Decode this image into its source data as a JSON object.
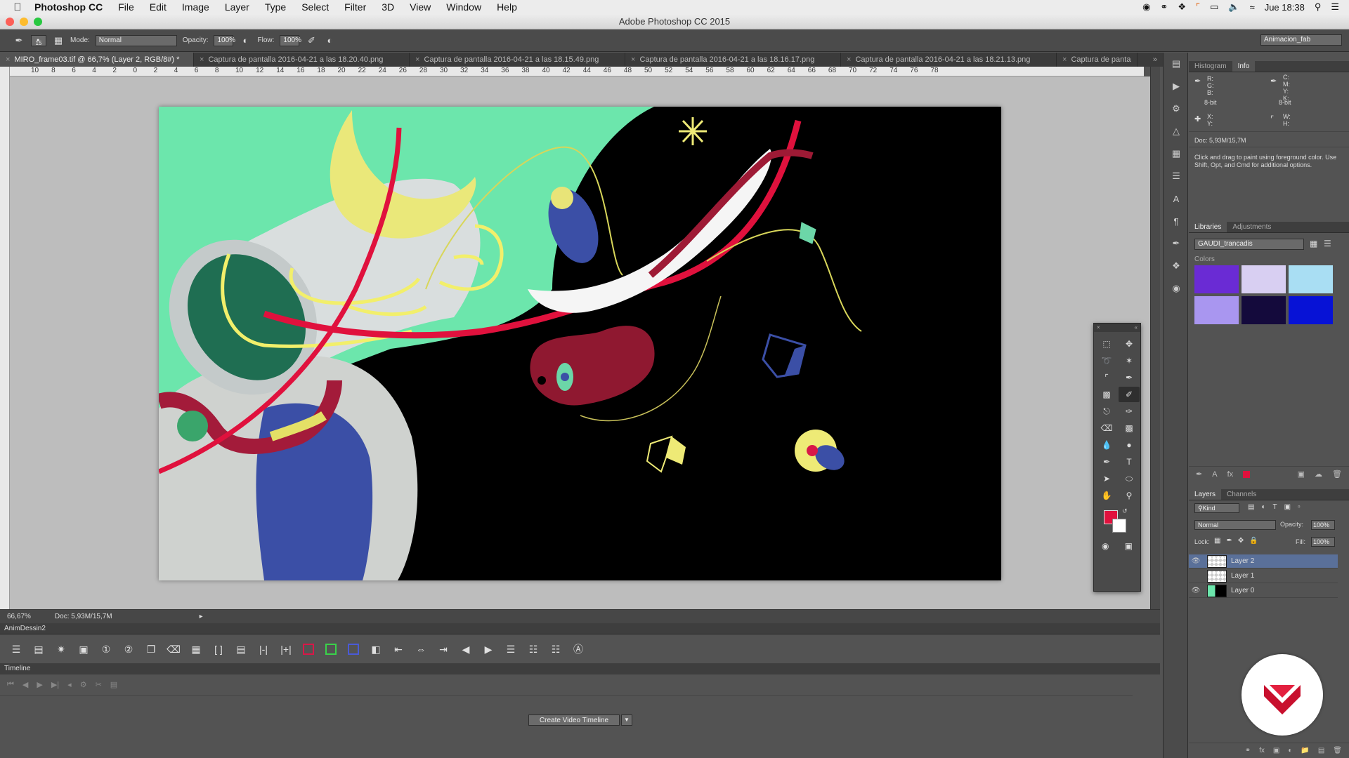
{
  "menubar": {
    "apple": "",
    "app": "Photoshop CC",
    "items": [
      "File",
      "Edit",
      "Image",
      "Layer",
      "Type",
      "Select",
      "Filter",
      "3D",
      "View",
      "Window",
      "Help"
    ],
    "clock": "Jue 18:38"
  },
  "window": {
    "title": "Adobe Photoshop CC 2015"
  },
  "options": {
    "brush_size": "15",
    "mode_label": "Mode:",
    "mode_value": "Normal",
    "opacity_label": "Opacity:",
    "opacity_value": "100%",
    "flow_label": "Flow:",
    "flow_value": "100%",
    "workspace": "Animacion_fab"
  },
  "tabs": [
    {
      "label": "MIRO_frame03.tif @ 66,7% (Layer 2, RGB/8#) *",
      "active": true
    },
    {
      "label": "Captura de pantalla 2016-04-21 a las 18.20.40.png",
      "active": false
    },
    {
      "label": "Captura de pantalla 2016-04-21 a las 18.15.49.png",
      "active": false
    },
    {
      "label": "Captura de pantalla 2016-04-21 a las 18.16.17.png",
      "active": false
    },
    {
      "label": "Captura de pantalla 2016-04-21 a las 18.21.13.png",
      "active": false
    },
    {
      "label": "Captura de panta",
      "active": false
    }
  ],
  "ruler_top": [
    "10",
    "8",
    "6",
    "4",
    "2",
    "0",
    "2",
    "4",
    "6",
    "8",
    "10",
    "12",
    "14",
    "16",
    "18",
    "20",
    "22",
    "24",
    "26",
    "28",
    "30",
    "32",
    "34",
    "36",
    "38",
    "40",
    "42",
    "44",
    "46",
    "48",
    "50",
    "52",
    "54",
    "56",
    "58",
    "60",
    "62",
    "64",
    "66",
    "68",
    "70",
    "72",
    "74",
    "76",
    "78"
  ],
  "status": {
    "zoom": "66,67%",
    "doc": "Doc: 5,93M/15,7M"
  },
  "anim_panel": {
    "title": "AnimDessin2"
  },
  "timeline": {
    "title": "Timeline",
    "create_button": "Create Video Timeline"
  },
  "info_panel": {
    "tabs": [
      "Histogram",
      "Info"
    ],
    "rgb": "R:\nG:\nB:",
    "cmyk": "C:\nM:\nY:\nK:",
    "bit_left": "8-bit",
    "bit_right": "8-bit",
    "xy": "X:\nY:",
    "wh": "W:\nH:",
    "doc": "Doc: 5,93M/15,7M",
    "hint": "Click and drag to paint using foreground color.  Use Shift, Opt, and Cmd for additional options."
  },
  "libraries_panel": {
    "tabs": [
      "Libraries",
      "Adjustments"
    ],
    "library": "GAUDI_trancadis",
    "colors_label": "Colors",
    "swatches": [
      "#6a2bd4",
      "#d8cff2",
      "#a9def3",
      "#a996f0",
      "#140a3c",
      "#0712d6"
    ]
  },
  "layers_panel": {
    "tabs": [
      "Layers",
      "Channels"
    ],
    "kind": "Kind",
    "blend": "Normal",
    "opacity_label": "Opacity:",
    "opacity_value": "100%",
    "lock_label": "Lock:",
    "fill_label": "Fill:",
    "fill_value": "100%",
    "layers": [
      {
        "name": "Layer 2",
        "visible": true,
        "selected": true
      },
      {
        "name": "Layer 1",
        "visible": false,
        "selected": false
      },
      {
        "name": "Layer 0",
        "visible": true,
        "selected": false
      }
    ]
  },
  "colors": {
    "foreground": "#e0113d",
    "background": "#ffffff",
    "accent_red": "#d81748",
    "selection": "#5a7099"
  }
}
